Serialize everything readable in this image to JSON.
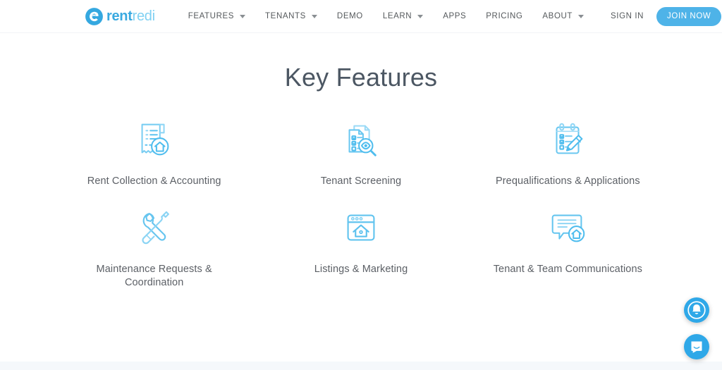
{
  "header": {
    "logo": {
      "icon": "rentredi-swirl-logo-icon",
      "text_primary": "rent",
      "text_secondary": "redi"
    },
    "nav_items": [
      {
        "label": "FEATURES",
        "has_dropdown": true
      },
      {
        "label": "TENANTS",
        "has_dropdown": true
      },
      {
        "label": "DEMO",
        "has_dropdown": false
      },
      {
        "label": "LEARN",
        "has_dropdown": true
      },
      {
        "label": "APPS",
        "has_dropdown": false
      },
      {
        "label": "PRICING",
        "has_dropdown": false
      },
      {
        "label": "ABOUT",
        "has_dropdown": true
      }
    ],
    "sign_in_label": "SIGN IN",
    "join_now_label": "JOIN NOW",
    "accent_color": "#4eb3e8"
  },
  "main": {
    "title": "Key Features",
    "features": [
      {
        "label": "Rent Collection & Accounting",
        "icon": "receipt-house-icon"
      },
      {
        "label": "Tenant Screening",
        "icon": "documents-magnifier-icon"
      },
      {
        "label": "Prequalifications & Applications",
        "icon": "clipboard-pencil-icon"
      },
      {
        "label": "Maintenance Requests & Coordination",
        "icon": "wrench-screwdriver-icon"
      },
      {
        "label": "Listings & Marketing",
        "icon": "browser-house-icon"
      },
      {
        "label": "Tenant & Team Communications",
        "icon": "chat-bubble-house-icon"
      }
    ],
    "icon_color": "#57c0ee",
    "title_color": "#4c5763",
    "label_color": "#5c6066"
  },
  "floating": {
    "notification_label": "Notifications",
    "notification_icon": "bell-icon",
    "messenger_label": "Open messenger",
    "messenger_icon": "intercom-messenger-icon",
    "color": "#2fa8e8"
  }
}
